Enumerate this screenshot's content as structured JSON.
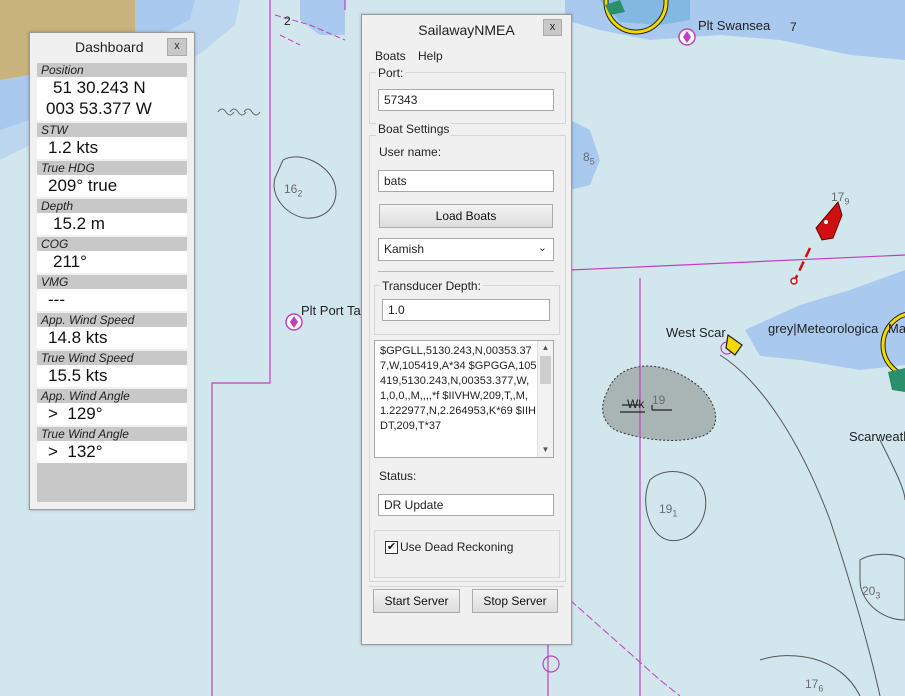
{
  "chart": {
    "labels": {
      "plt_swansea": "Plt Swansea",
      "plt_port_ta": "Plt Port Ta",
      "west_scar": "West Scar",
      "grey_meteorological": "grey|Meteorologica",
      "ma": "Ma",
      "scarweath": "Scarweath",
      "wk": "Wk",
      "num_2": "2",
      "num_7": "7"
    },
    "soundings": [
      {
        "main": "16",
        "sub": "2"
      },
      {
        "main": "8",
        "sub": "5"
      },
      {
        "main": "17",
        "sub": "9"
      },
      {
        "main": "19",
        "sub": ""
      },
      {
        "main": "19",
        "sub": "1"
      },
      {
        "main": "20",
        "sub": "3"
      },
      {
        "main": "17",
        "sub": "6"
      }
    ]
  },
  "dashboard": {
    "title": "Dashboard",
    "close_label": "x",
    "widgets": [
      {
        "label": "Position",
        "lines": [
          "51 30.243 N",
          "003 53.377 W"
        ]
      },
      {
        "label": "STW",
        "lines": [
          "1.2 kts"
        ]
      },
      {
        "label": "True HDG",
        "lines": [
          "209° true"
        ]
      },
      {
        "label": "Depth",
        "lines": [
          "15.2 m"
        ]
      },
      {
        "label": "COG",
        "lines": [
          "211°"
        ]
      },
      {
        "label": "VMG",
        "lines": [
          "---"
        ]
      },
      {
        "label": "App. Wind Speed",
        "lines": [
          "14.8 kts"
        ]
      },
      {
        "label": "True Wind Speed",
        "lines": [
          "15.5 kts"
        ]
      },
      {
        "label": "App. Wind Angle",
        "lines": [
          ">  129°"
        ]
      },
      {
        "label": "True Wind Angle",
        "lines": [
          ">  132°"
        ]
      }
    ]
  },
  "nmea": {
    "title": "SailawayNMEA",
    "close_label": "x",
    "menu": [
      "Boats",
      "Help"
    ],
    "port_label": "Port:",
    "port_value": "57343",
    "boat_settings_label": "Boat Settings",
    "user_name_label": "User name:",
    "user_name_value": "bats",
    "load_boats_label": "Load Boats",
    "boat_selected": "Kamish",
    "transducer_label": "Transducer Depth:",
    "transducer_value": "1.0",
    "log_text": "$GPGLL,5130.243,N,00353.377,W,105419,A*34 $GPGGA,105419,5130.243,N,00353.377,W,1,0,0,,M,,,,*f $IIVHW,209,T,,M,1.222977,N,2.264953,K*69 $IIHDT,209,T*37",
    "status_label": "Status:",
    "status_value": "DR Update",
    "dead_reckoning_label": "Use Dead Reckoning",
    "dead_reckoning_checked": true,
    "start_server_label": "Start Server",
    "stop_server_label": "Stop Server"
  },
  "colors": {
    "water": "#d2e6ee",
    "shallow": "#a9c9ef",
    "land": "#c9b37c",
    "route": "#c040c0",
    "boat": "#d01010"
  }
}
